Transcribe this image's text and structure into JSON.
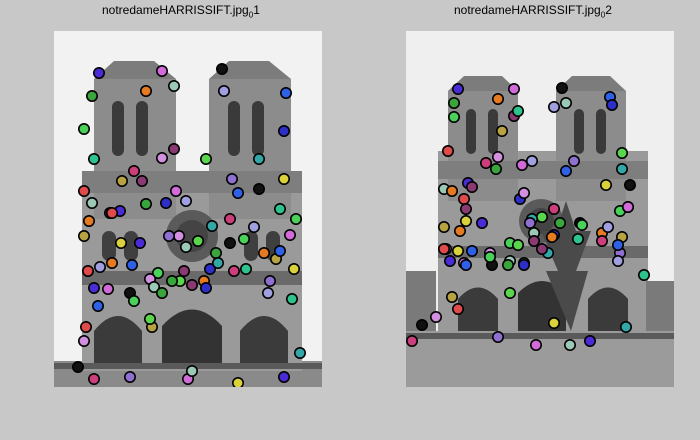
{
  "figures": [
    {
      "title_main": "notredameHARRISSIFT.jpg",
      "title_sub": "0",
      "title_suffix": "1",
      "keypoints": [
        {
          "c": "#4a2bd6"
        },
        {
          "c": "#d26bd9"
        },
        {
          "c": "#111111"
        },
        {
          "c": "#9bc9b6"
        },
        {
          "c": "#3aa43d"
        },
        {
          "c": "#e57a21"
        },
        {
          "c": "#a0a0e0"
        },
        {
          "c": "#2f61e6"
        },
        {
          "c": "#4ad15a"
        },
        {
          "c": "#8a3a72"
        },
        {
          "c": "#2d2fc8"
        },
        {
          "c": "#2ec28d"
        },
        {
          "c": "#b7a341"
        },
        {
          "c": "#e04a4a"
        },
        {
          "c": "#d38fe0"
        },
        {
          "c": "#5ad64c"
        },
        {
          "c": "#33a6a6"
        },
        {
          "c": "#cc3f7c"
        },
        {
          "c": "#8f6fcf"
        },
        {
          "c": "#d9d23a"
        }
      ]
    },
    {
      "title_main": "notredameHARRISSIFT.jpg",
      "title_sub": "0",
      "title_suffix": "2",
      "keypoints": [
        {
          "c": "#4a2bd6"
        },
        {
          "c": "#d26bd9"
        },
        {
          "c": "#111111"
        },
        {
          "c": "#9bc9b6"
        },
        {
          "c": "#3aa43d"
        },
        {
          "c": "#e57a21"
        },
        {
          "c": "#a0a0e0"
        },
        {
          "c": "#2f61e6"
        },
        {
          "c": "#4ad15a"
        },
        {
          "c": "#8a3a72"
        },
        {
          "c": "#2d2fc8"
        },
        {
          "c": "#2ec28d"
        },
        {
          "c": "#b7a341"
        },
        {
          "c": "#e04a4a"
        },
        {
          "c": "#d38fe0"
        },
        {
          "c": "#5ad64c"
        },
        {
          "c": "#33a6a6"
        },
        {
          "c": "#cc3f7c"
        },
        {
          "c": "#8f6fcf"
        },
        {
          "c": "#d9d23a"
        }
      ]
    }
  ]
}
